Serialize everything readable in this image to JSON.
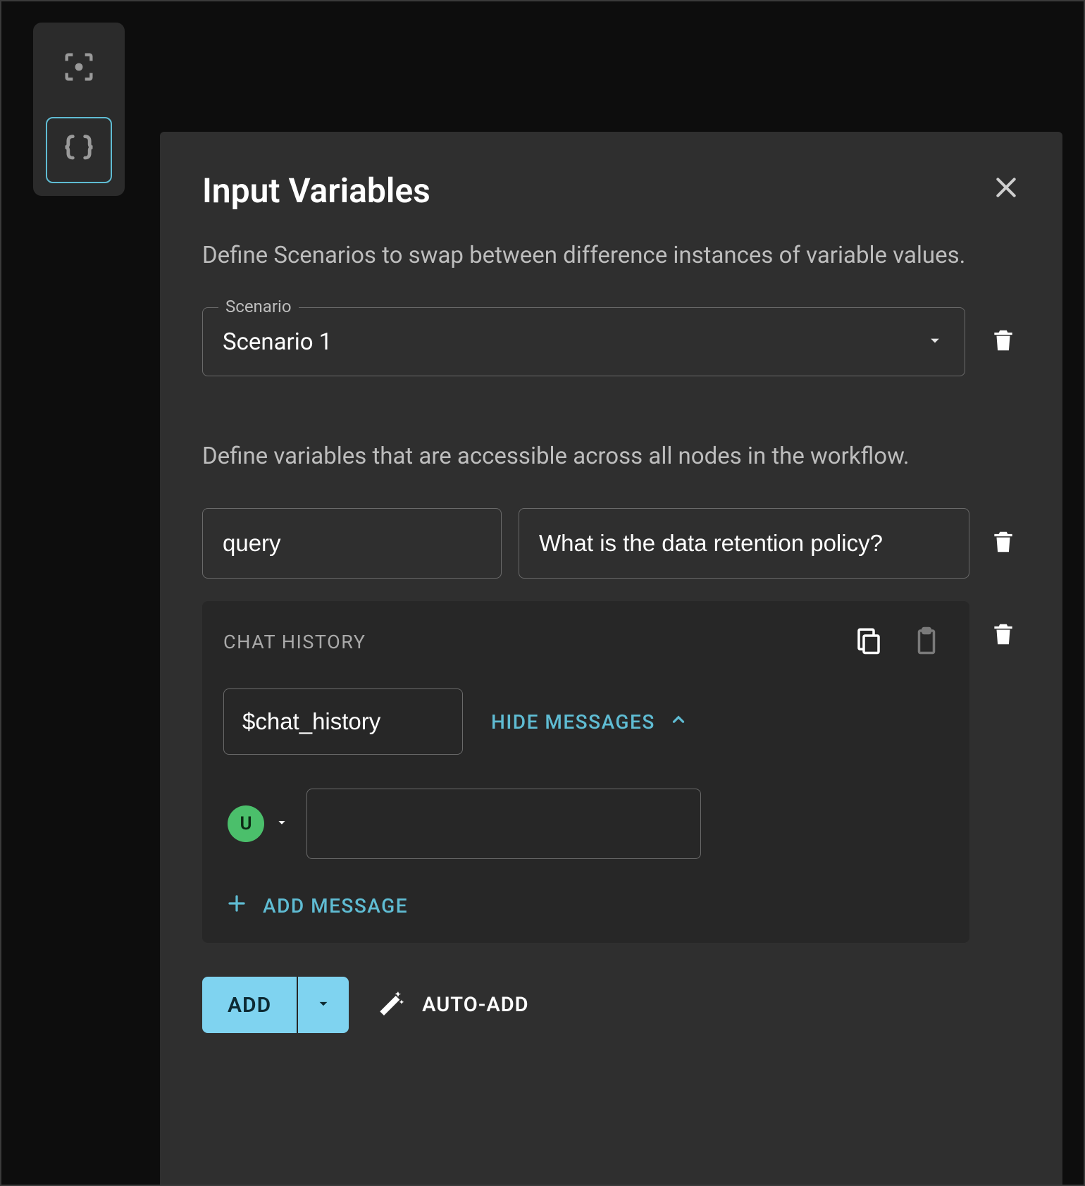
{
  "panel": {
    "title": "Input Variables",
    "description_scenarios": "Define Scenarios to swap between difference instances of variable values.",
    "scenario_legend": "Scenario",
    "scenario_value": "Scenario 1",
    "description_variables": "Define variables that are accessible across all nodes in the workflow."
  },
  "variable": {
    "name": "query",
    "value": "What is the data retention policy?"
  },
  "chat": {
    "label": "CHAT HISTORY",
    "var_name": "$chat_history",
    "hide_label": "HIDE MESSAGES",
    "role_initial": "U",
    "message_value": "",
    "add_message_label": "ADD MESSAGE"
  },
  "footer": {
    "add_label": "ADD",
    "auto_add_label": "AUTO-ADD"
  }
}
